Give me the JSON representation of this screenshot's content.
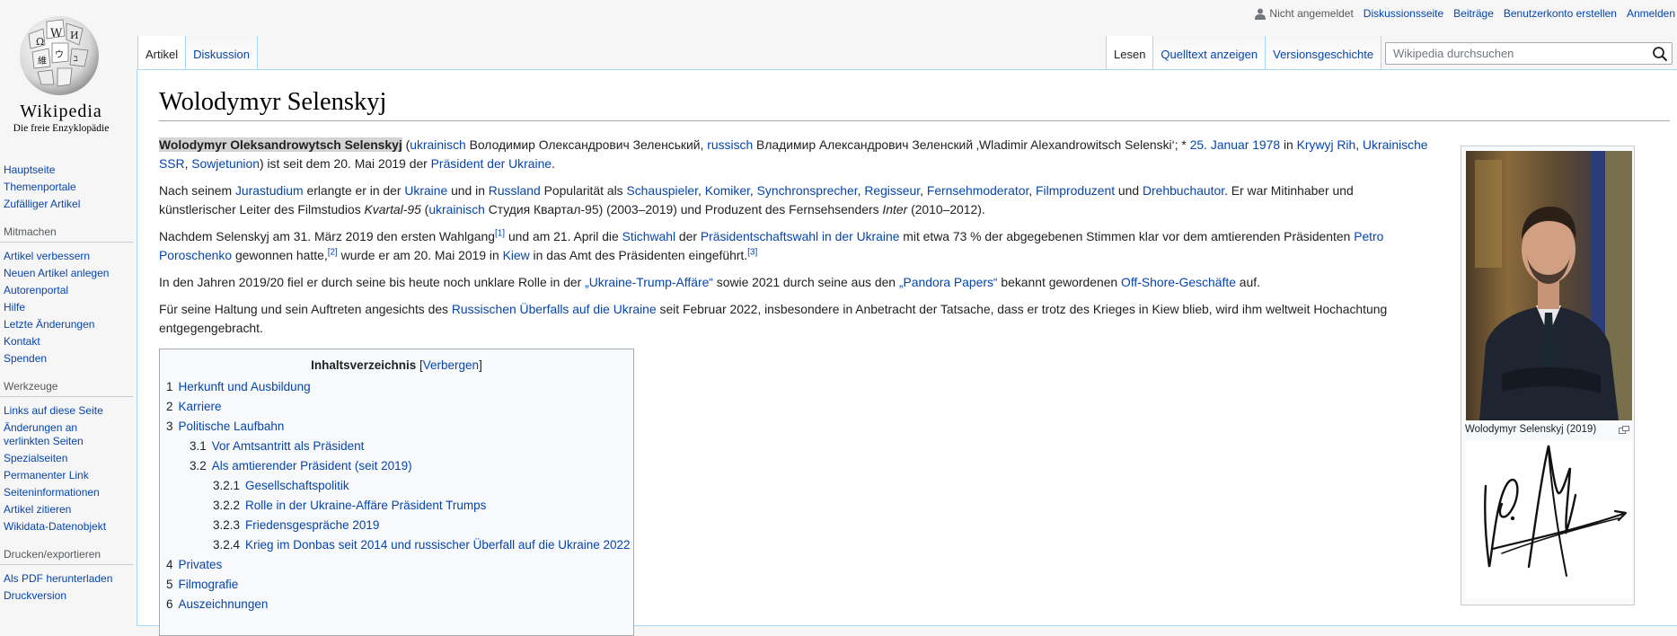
{
  "logo": {
    "wordmark": "Wikipedia",
    "tagline": "Die freie Enzyklopädie"
  },
  "personal": {
    "not_logged": "Nicht angemeldet",
    "links": [
      "Diskussionsseite",
      "Beiträge",
      "Benutzerkonto erstellen",
      "Anmelden"
    ]
  },
  "tabs_left": [
    "Artikel",
    "Diskussion"
  ],
  "tabs_right": [
    "Lesen",
    "Quelltext anzeigen",
    "Versionsgeschichte"
  ],
  "search": {
    "placeholder": "Wikipedia durchsuchen",
    "icon": "search-icon"
  },
  "sidebar": {
    "nav": [
      "Hauptseite",
      "Themenportale",
      "Zufälliger Artikel"
    ],
    "mitmachen": {
      "heading": "Mitmachen",
      "items": [
        "Artikel verbessern",
        "Neuen Artikel anlegen",
        "Autorenportal",
        "Hilfe",
        "Letzte Änderungen",
        "Kontakt",
        "Spenden"
      ]
    },
    "werkzeuge": {
      "heading": "Werkzeuge",
      "items": [
        "Links auf diese Seite",
        "Änderungen an verlinkten Seiten",
        "Spezialseiten",
        "Permanenter Link",
        "Seiteninformationen",
        "Artikel zitieren",
        "Wikidata-Datenobjekt"
      ]
    },
    "drucken": {
      "heading": "Drucken/exportieren",
      "items": [
        "Als PDF herunterladen",
        "Druckversion"
      ]
    }
  },
  "article": {
    "title": "Wolodymyr Selenskyj",
    "p1": {
      "name": "Wolodymyr Oleksandrowytsch Selenskyj",
      "t1": " (",
      "l_ukr": "ukrainisch",
      "t2": " Володимир Олександрович Зеленський, ",
      "l_rus": "russisch",
      "t3": " Владимир Александрович Зеленский ‚Wladimir Alexandrowitsch Selenski‘; * ",
      "l_date": "25. Januar 1978",
      "t4": " in ",
      "l_place": "Krywyj Rih",
      "t5": ", ",
      "l_ssr": "Ukrainische SSR",
      "t6": ", ",
      "l_su": "Sowjetunion",
      "t7": ") ist seit dem 20. Mai 2019 der ",
      "l_pres": "Präsident der Ukraine",
      "t8": "."
    },
    "p2": {
      "t1": "Nach seinem ",
      "l1": "Jurastudium",
      "t2": " erlangte er in der ",
      "l2": "Ukraine",
      "t3": " und in ",
      "l3": "Russland",
      "t4": " Popularität als ",
      "l4": "Schauspieler",
      "t5": ", ",
      "l5": "Komiker",
      "t6": ", ",
      "l6": "Synchronsprecher",
      "t7": ", ",
      "l7": "Regisseur",
      "t8": ", ",
      "l8": "Fernsehmoderator",
      "t9": ", ",
      "l9": "Filmproduzent",
      "t10": " und ",
      "l10": "Drehbuchautor",
      "t11": ". Er war Mitinhaber und künstlerischer Leiter des Filmstudios ",
      "i1": "Kvartal-95",
      "t12": " (",
      "l11": "ukrainisch",
      "t13": " Студия Квартал-95) (2003–2019) und Produzent des Fernsehsenders ",
      "i2": "Inter",
      "t14": " (2010–2012)."
    },
    "p3": {
      "t1": "Nachdem Selenskyj am 31. März 2019 den ersten Wahlgang",
      "r1": "[1]",
      "t2": " und am 21. April die ",
      "l1": "Stichwahl",
      "t3": " der ",
      "l2": "Präsidentschaftswahl in der Ukraine",
      "t4": " mit etwa 73 % der abgegebenen Stimmen klar vor dem amtierenden Präsidenten ",
      "l3": "Petro Poroschenko",
      "t5": " gewonnen hatte,",
      "r2": "[2]",
      "t6": " wurde er am 20. Mai 2019 in ",
      "l4": "Kiew",
      "t7": " in das Amt des Präsidenten eingeführt.",
      "r3": "[3]"
    },
    "p4": {
      "t1": "In den Jahren 2019/20 fiel er durch seine bis heute noch unklare Rolle in der ",
      "l1": "„Ukraine-Trump-Affäre“",
      "t2": " sowie 2021 durch seine aus den ",
      "l2": "„Pandora Papers“",
      "t3": " bekannt gewordenen ",
      "l3": "Off-Shore-Geschäfte",
      "t4": " auf."
    },
    "p5": {
      "t1": "Für seine Haltung und sein Auftreten angesichts des ",
      "l1": "Russischen Überfalls auf die Ukraine",
      "t2": " seit Februar 2022, insbesondere in Anbetracht der Tatsache, dass er trotz des Krieges in Kiew blieb, wird ihm weltweit Hochachtung entgegengebracht."
    }
  },
  "toc": {
    "title": "Inhaltsverzeichnis",
    "toggle": "Verbergen",
    "items": [
      {
        "num": "1",
        "label": "Herkunft und Ausbildung"
      },
      {
        "num": "2",
        "label": "Karriere"
      },
      {
        "num": "3",
        "label": "Politische Laufbahn"
      },
      {
        "num": "3.1",
        "label": "Vor Amtsantritt als Präsident"
      },
      {
        "num": "3.2",
        "label": "Als amtierender Präsident (seit 2019)"
      },
      {
        "num": "3.2.1",
        "label": "Gesellschaftspolitik"
      },
      {
        "num": "3.2.2",
        "label": "Rolle in der Ukraine-Affäre Präsident Trumps"
      },
      {
        "num": "3.2.3",
        "label": "Friedensgespräche 2019"
      },
      {
        "num": "3.2.4",
        "label": "Krieg im Donbas seit 2014 und russischer Überfall auf die Ukraine 2022"
      },
      {
        "num": "4",
        "label": "Privates"
      },
      {
        "num": "5",
        "label": "Filmografie"
      },
      {
        "num": "6",
        "label": "Auszeichnungen"
      }
    ]
  },
  "infobox": {
    "caption": "Wolodymyr Selenskyj (2019)"
  },
  "colors": {
    "link": "#0645ad",
    "border": "#a7d7f9",
    "bg": "#f6f6f6"
  }
}
